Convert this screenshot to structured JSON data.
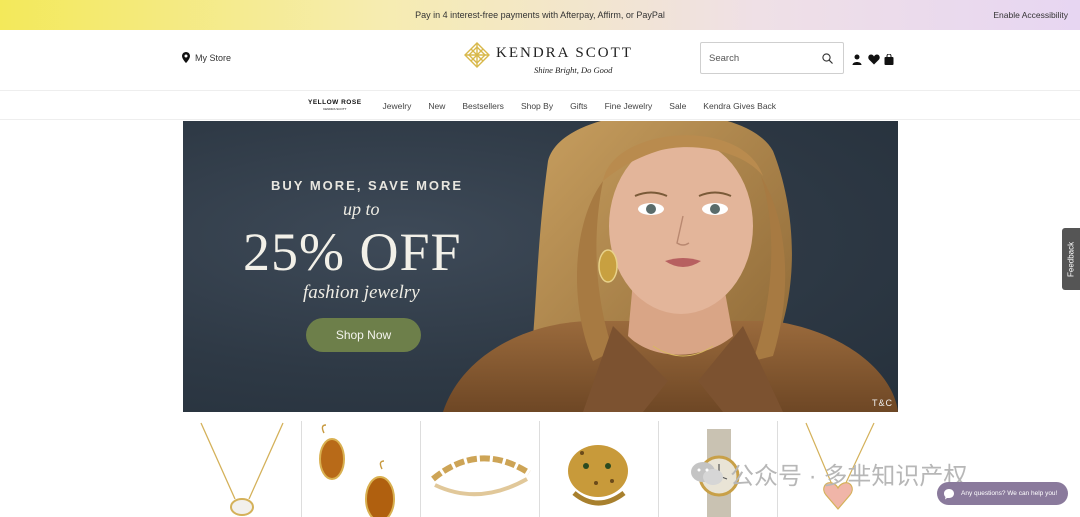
{
  "promo": {
    "message": "Pay in 4 interest-free payments with Afterpay, Affirm, or PayPal",
    "accessibility_link": "Enable Accessibility"
  },
  "header": {
    "store_label": "My Store",
    "brand_name": "KENDRA SCOTT",
    "tagline": "Shine Bright, Do Good",
    "search_placeholder": "Search",
    "icons": [
      "map-pin-icon",
      "search-icon",
      "account-icon",
      "heart-icon",
      "bag-icon"
    ]
  },
  "nav": {
    "sub_brand": "YELLOW ROSE",
    "sub_brand_small": "KENDRA SCOTT",
    "items": [
      "Jewelry",
      "New",
      "Bestsellers",
      "Shop By",
      "Gifts",
      "Fine Jewelry",
      "Sale",
      "Kendra Gives Back"
    ]
  },
  "hero": {
    "kicker": "BUY MORE, SAVE MORE",
    "upto": "up to",
    "headline": "25% OFF",
    "subline": "fashion jewelry",
    "cta": "Shop Now",
    "terms": "T&C"
  },
  "feedback_tab": "Feedback",
  "products": [
    {
      "icon": "necklace-icon"
    },
    {
      "icon": "earrings-icon"
    },
    {
      "icon": "bracelet-icon"
    },
    {
      "icon": "leopard-ring-icon"
    },
    {
      "icon": "watch-icon"
    },
    {
      "icon": "heart-necklace-icon"
    }
  ],
  "watermark": "公众号 · 多芈知识产权",
  "chat": {
    "label": "Any questions? We can help you!"
  },
  "colors": {
    "promo_gradient_start": "#f3e95a",
    "promo_gradient_end": "#e7d6f2",
    "hero_bg": "#2e3945",
    "cta_green": "#6d7f4a",
    "chat_purple": "#8a7a9c",
    "logo_gold": "#d8b84a"
  }
}
